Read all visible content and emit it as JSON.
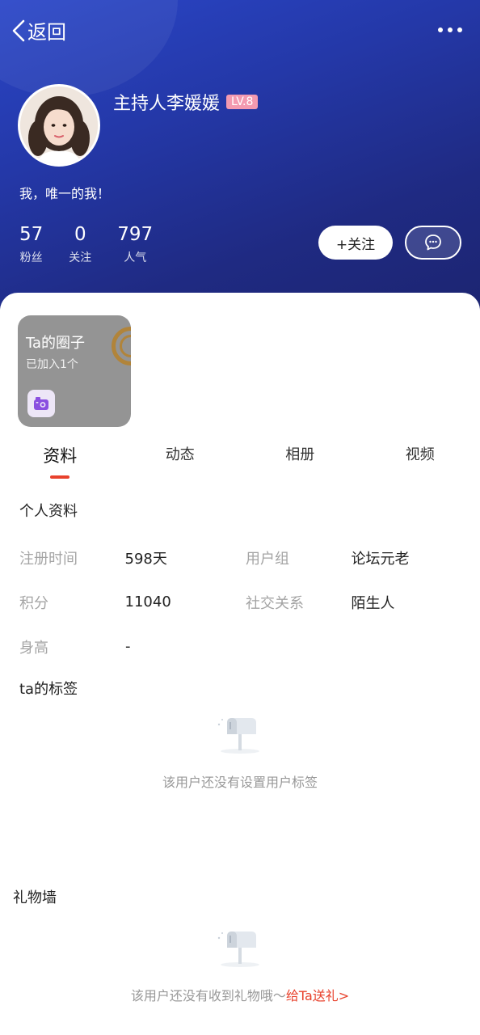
{
  "nav": {
    "back_label": "返回"
  },
  "profile": {
    "name": "主持人李媛媛",
    "level": "LV.8",
    "bio": "我，唯一的我！",
    "stats": [
      {
        "value": "57",
        "label": "粉丝"
      },
      {
        "value": "0",
        "label": "关注"
      },
      {
        "value": "797",
        "label": "人气"
      }
    ],
    "follow_label": "+关注"
  },
  "circle": {
    "title": "Ta的圈子",
    "subtitle": "已加入1个"
  },
  "tabs": [
    "资料",
    "动态",
    "相册",
    "视频"
  ],
  "personal_info": {
    "title": "个人资料",
    "rows": [
      {
        "k1": "注册时间",
        "v1": "598天",
        "k2": "用户组",
        "v2": "论坛元老"
      },
      {
        "k1": "积分",
        "v1": "11040",
        "k2": "社交关系",
        "v2": "陌生人"
      },
      {
        "k1": "身高",
        "v1": "-",
        "k2": "",
        "v2": ""
      }
    ]
  },
  "tags": {
    "title": "ta的标签",
    "empty_text": "该用户还没有设置用户标签"
  },
  "gifts": {
    "title": "礼物墙",
    "empty_text": "该用户还没有收到礼物哦～",
    "link_text": "给Ta送礼>"
  },
  "colors": {
    "accent": "#e8412c",
    "header": "#2438a8",
    "level_badge": "#f39ab0"
  }
}
